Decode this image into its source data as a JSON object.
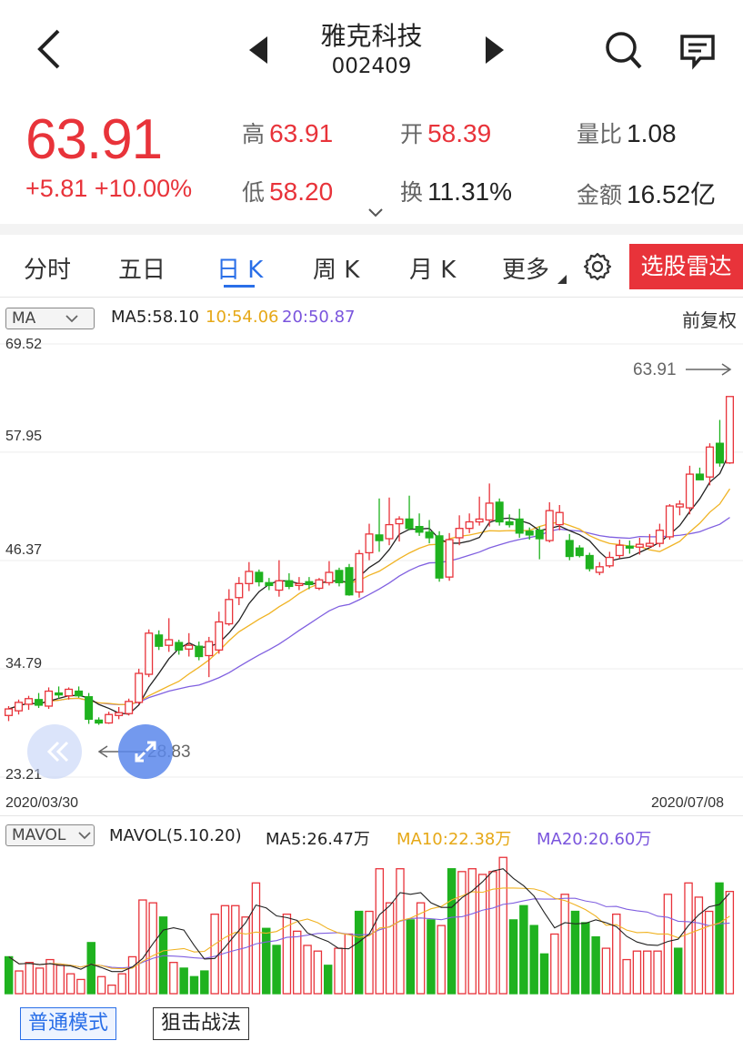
{
  "header": {
    "title": "雅克科技",
    "code": "002409"
  },
  "quote": {
    "price": "63.91",
    "change": "+5.81 +10.00%",
    "high_label": "高",
    "high": "63.91",
    "low_label": "低",
    "low": "58.20",
    "open_label": "开",
    "open": "58.39",
    "turnover_label": "换",
    "turnover": "11.31%",
    "vol_ratio_label": "量比",
    "vol_ratio": "1.08",
    "amount_label": "金额",
    "amount": "16.52亿"
  },
  "tabs": [
    "分时",
    "五日",
    "日 K",
    "周 K",
    "月 K",
    "更多"
  ],
  "active_tab": "日 K",
  "radar_button": "选股雷达",
  "main_chart": {
    "indicator": "MA",
    "ma5": "MA5:58.10",
    "ma10": "10:54.06",
    "ma20": "20:50.87",
    "adjust": "前复权",
    "y_ticks": [
      "69.52",
      "57.95",
      "46.37",
      "34.79",
      "23.21"
    ],
    "last_price_label": "63.91",
    "low_label": "28.83",
    "date_start": "2020/03/30",
    "date_end": "2020/07/08"
  },
  "volume_chart": {
    "indicator": "MAVOL",
    "title": "MAVOL(5.10.20)",
    "ma5": "MA5:26.47万",
    "ma10": "MA10:22.38万",
    "ma20": "MA20:20.60万"
  },
  "modes": [
    "普通模式",
    "狙击战法"
  ],
  "active_mode": "普通模式",
  "colors": {
    "up": "#e8333a",
    "down": "#1fb21f",
    "ma5": "#222222",
    "ma10": "#f0b323",
    "ma20": "#8060e0",
    "accent": "#2a6fe8"
  },
  "chart_data": {
    "type": "candlestick",
    "ylim": [
      23.21,
      69.52
    ],
    "y_ticks": [
      69.52,
      57.95,
      46.37,
      34.79,
      23.21
    ],
    "candles": [
      {
        "o": 29.8,
        "h": 30.8,
        "l": 29.2,
        "c": 30.5
      },
      {
        "o": 30.3,
        "h": 31.5,
        "l": 29.9,
        "c": 31.2
      },
      {
        "o": 31.0,
        "h": 31.9,
        "l": 30.4,
        "c": 31.6
      },
      {
        "o": 31.5,
        "h": 32.2,
        "l": 30.6,
        "c": 30.9
      },
      {
        "o": 30.8,
        "h": 32.8,
        "l": 30.5,
        "c": 32.4
      },
      {
        "o": 32.2,
        "h": 32.9,
        "l": 31.6,
        "c": 32.0
      },
      {
        "o": 31.9,
        "h": 32.8,
        "l": 31.5,
        "c": 32.6
      },
      {
        "o": 32.4,
        "h": 32.9,
        "l": 31.7,
        "c": 31.9
      },
      {
        "o": 31.8,
        "h": 32.2,
        "l": 28.9,
        "c": 29.4
      },
      {
        "o": 29.3,
        "h": 29.6,
        "l": 28.8,
        "c": 29.0
      },
      {
        "o": 29.0,
        "h": 30.2,
        "l": 28.9,
        "c": 29.9
      },
      {
        "o": 29.8,
        "h": 30.7,
        "l": 29.4,
        "c": 30.1
      },
      {
        "o": 30.0,
        "h": 31.6,
        "l": 29.8,
        "c": 31.3
      },
      {
        "o": 31.2,
        "h": 34.8,
        "l": 31.0,
        "c": 34.3
      },
      {
        "o": 34.2,
        "h": 39.0,
        "l": 33.9,
        "c": 38.6
      },
      {
        "o": 38.4,
        "h": 38.9,
        "l": 36.8,
        "c": 37.2
      },
      {
        "o": 37.3,
        "h": 40.2,
        "l": 36.6,
        "c": 37.9
      },
      {
        "o": 37.6,
        "h": 37.9,
        "l": 36.3,
        "c": 36.8
      },
      {
        "o": 36.9,
        "h": 38.6,
        "l": 36.1,
        "c": 37.3
      },
      {
        "o": 37.2,
        "h": 37.7,
        "l": 35.7,
        "c": 36.1
      },
      {
        "o": 36.2,
        "h": 38.2,
        "l": 33.9,
        "c": 37.7
      },
      {
        "o": 36.8,
        "h": 40.9,
        "l": 36.4,
        "c": 39.8
      },
      {
        "o": 39.6,
        "h": 43.3,
        "l": 39.4,
        "c": 42.2
      },
      {
        "o": 42.4,
        "h": 44.6,
        "l": 41.6,
        "c": 43.9
      },
      {
        "o": 43.9,
        "h": 46.2,
        "l": 43.1,
        "c": 45.2
      },
      {
        "o": 45.1,
        "h": 45.4,
        "l": 43.6,
        "c": 44.1
      },
      {
        "o": 44.0,
        "h": 44.5,
        "l": 43.2,
        "c": 43.7
      },
      {
        "o": 43.2,
        "h": 46.4,
        "l": 42.5,
        "c": 44.2
      },
      {
        "o": 44.2,
        "h": 45.0,
        "l": 43.3,
        "c": 43.6
      },
      {
        "o": 43.7,
        "h": 44.6,
        "l": 43.2,
        "c": 43.9
      },
      {
        "o": 44.1,
        "h": 44.6,
        "l": 43.3,
        "c": 43.8
      },
      {
        "o": 43.4,
        "h": 44.5,
        "l": 43.2,
        "c": 44.3
      },
      {
        "o": 44.0,
        "h": 46.3,
        "l": 43.7,
        "c": 45.1
      },
      {
        "o": 45.3,
        "h": 45.6,
        "l": 43.6,
        "c": 44.0
      },
      {
        "o": 45.6,
        "h": 46.0,
        "l": 42.6,
        "c": 42.7
      },
      {
        "o": 43.0,
        "h": 47.5,
        "l": 42.4,
        "c": 47.1
      },
      {
        "o": 47.2,
        "h": 50.3,
        "l": 46.4,
        "c": 49.2
      },
      {
        "o": 49.1,
        "h": 53.0,
        "l": 47.3,
        "c": 48.5
      },
      {
        "o": 48.7,
        "h": 53.1,
        "l": 48.0,
        "c": 50.2
      },
      {
        "o": 50.3,
        "h": 51.1,
        "l": 48.4,
        "c": 50.8
      },
      {
        "o": 50.8,
        "h": 53.3,
        "l": 49.6,
        "c": 49.8
      },
      {
        "o": 50.0,
        "h": 51.4,
        "l": 49.0,
        "c": 49.4
      },
      {
        "o": 49.4,
        "h": 50.7,
        "l": 48.2,
        "c": 48.8
      },
      {
        "o": 49.0,
        "h": 49.5,
        "l": 44.1,
        "c": 44.5
      },
      {
        "o": 44.6,
        "h": 49.3,
        "l": 44.2,
        "c": 48.6
      },
      {
        "o": 48.8,
        "h": 51.2,
        "l": 48.0,
        "c": 49.8
      },
      {
        "o": 49.8,
        "h": 51.4,
        "l": 49.3,
        "c": 50.5
      },
      {
        "o": 50.5,
        "h": 53.2,
        "l": 50.1,
        "c": 50.8
      },
      {
        "o": 50.7,
        "h": 54.6,
        "l": 50.0,
        "c": 52.5
      },
      {
        "o": 52.6,
        "h": 53.0,
        "l": 50.1,
        "c": 50.5
      },
      {
        "o": 50.5,
        "h": 51.3,
        "l": 49.9,
        "c": 50.2
      },
      {
        "o": 50.8,
        "h": 51.9,
        "l": 48.8,
        "c": 49.3
      },
      {
        "o": 49.5,
        "h": 49.9,
        "l": 48.6,
        "c": 49.1
      },
      {
        "o": 49.6,
        "h": 50.0,
        "l": 46.5,
        "c": 48.7
      },
      {
        "o": 48.5,
        "h": 52.6,
        "l": 48.3,
        "c": 51.7
      },
      {
        "o": 50.2,
        "h": 52.3,
        "l": 49.6,
        "c": 51.5
      },
      {
        "o": 48.5,
        "h": 49.2,
        "l": 46.4,
        "c": 46.8
      },
      {
        "o": 47.7,
        "h": 48.0,
        "l": 46.7,
        "c": 46.9
      },
      {
        "o": 46.9,
        "h": 47.2,
        "l": 45.2,
        "c": 45.5
      },
      {
        "o": 45.1,
        "h": 46.2,
        "l": 44.8,
        "c": 45.7
      },
      {
        "o": 45.8,
        "h": 47.3,
        "l": 45.6,
        "c": 46.7
      },
      {
        "o": 46.9,
        "h": 48.6,
        "l": 46.6,
        "c": 48.0
      },
      {
        "o": 47.9,
        "h": 48.5,
        "l": 47.1,
        "c": 47.7
      },
      {
        "o": 47.8,
        "h": 48.8,
        "l": 47.0,
        "c": 48.1
      },
      {
        "o": 47.9,
        "h": 49.2,
        "l": 47.7,
        "c": 48.2
      },
      {
        "o": 48.2,
        "h": 50.3,
        "l": 47.8,
        "c": 49.6
      },
      {
        "o": 48.9,
        "h": 52.4,
        "l": 48.6,
        "c": 52.2
      },
      {
        "o": 52.1,
        "h": 52.8,
        "l": 51.2,
        "c": 52.4
      },
      {
        "o": 52.0,
        "h": 56.5,
        "l": 51.3,
        "c": 55.6
      },
      {
        "o": 55.6,
        "h": 56.3,
        "l": 55.0,
        "c": 55.0
      },
      {
        "o": 55.3,
        "h": 58.9,
        "l": 54.4,
        "c": 58.5
      },
      {
        "o": 58.9,
        "h": 61.4,
        "l": 56.4,
        "c": 56.8
      },
      {
        "o": 56.8,
        "h": 63.9,
        "l": 56.7,
        "c": 63.9
      }
    ],
    "volumes": [
      {
        "v": 13,
        "up": false
      },
      {
        "v": 8,
        "up": true
      },
      {
        "v": 11,
        "up": true
      },
      {
        "v": 9,
        "up": true
      },
      {
        "v": 12,
        "up": true
      },
      {
        "v": 10,
        "up": true
      },
      {
        "v": 7,
        "up": true
      },
      {
        "v": 5,
        "up": true
      },
      {
        "v": 18,
        "up": false
      },
      {
        "v": 6,
        "up": true
      },
      {
        "v": 3,
        "up": true
      },
      {
        "v": 7,
        "up": true
      },
      {
        "v": 13,
        "up": true
      },
      {
        "v": 33,
        "up": true
      },
      {
        "v": 32,
        "up": true
      },
      {
        "v": 27,
        "up": false
      },
      {
        "v": 11,
        "up": true
      },
      {
        "v": 9,
        "up": false
      },
      {
        "v": 6,
        "up": false
      },
      {
        "v": 8,
        "up": false
      },
      {
        "v": 28,
        "up": true
      },
      {
        "v": 31,
        "up": true
      },
      {
        "v": 31,
        "up": true
      },
      {
        "v": 27,
        "up": true
      },
      {
        "v": 39,
        "up": true
      },
      {
        "v": 23,
        "up": false
      },
      {
        "v": 17,
        "up": false
      },
      {
        "v": 28,
        "up": true
      },
      {
        "v": 22,
        "up": true
      },
      {
        "v": 17,
        "up": true
      },
      {
        "v": 15,
        "up": true
      },
      {
        "v": 10,
        "up": false
      },
      {
        "v": 16,
        "up": true
      },
      {
        "v": 21,
        "up": true
      },
      {
        "v": 29,
        "up": false
      },
      {
        "v": 29,
        "up": true
      },
      {
        "v": 44,
        "up": true
      },
      {
        "v": 32,
        "up": true
      },
      {
        "v": 44,
        "up": true
      },
      {
        "v": 26,
        "up": false
      },
      {
        "v": 32,
        "up": true
      },
      {
        "v": 26,
        "up": false
      },
      {
        "v": 24,
        "up": true
      },
      {
        "v": 44,
        "up": false
      },
      {
        "v": 43,
        "up": true
      },
      {
        "v": 44,
        "up": true
      },
      {
        "v": 42,
        "up": true
      },
      {
        "v": 43,
        "up": true
      },
      {
        "v": 48,
        "up": true
      },
      {
        "v": 26,
        "up": false
      },
      {
        "v": 31,
        "up": false
      },
      {
        "v": 24,
        "up": false
      },
      {
        "v": 14,
        "up": false
      },
      {
        "v": 21,
        "up": true
      },
      {
        "v": 35,
        "up": true
      },
      {
        "v": 29,
        "up": false
      },
      {
        "v": 25,
        "up": false
      },
      {
        "v": 20,
        "up": false
      },
      {
        "v": 16,
        "up": true
      },
      {
        "v": 28,
        "up": true
      },
      {
        "v": 12,
        "up": true
      },
      {
        "v": 15,
        "up": true
      },
      {
        "v": 15,
        "up": true
      },
      {
        "v": 15,
        "up": true
      },
      {
        "v": 35,
        "up": true
      },
      {
        "v": 16,
        "up": false
      },
      {
        "v": 39,
        "up": true
      },
      {
        "v": 34,
        "up": true
      },
      {
        "v": 29,
        "up": true
      },
      {
        "v": 39,
        "up": false
      },
      {
        "v": 36,
        "up": true
      }
    ]
  }
}
